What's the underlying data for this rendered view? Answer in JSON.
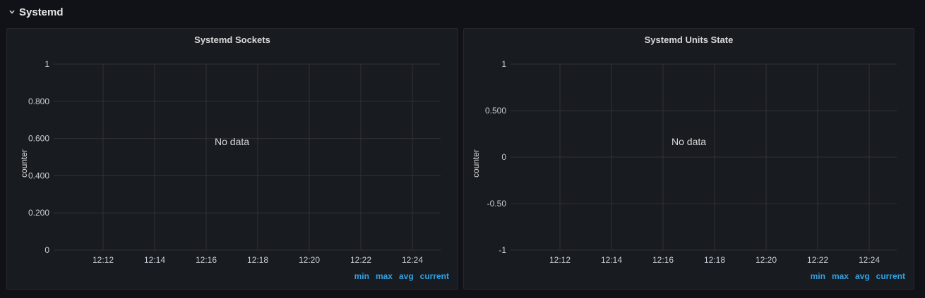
{
  "row": {
    "title": "Systemd",
    "chevron_icon": "chevron-down-icon"
  },
  "panels": [
    {
      "title": "Systemd Sockets",
      "ylabel": "counter",
      "no_data": "No data",
      "legend": [
        "min",
        "max",
        "avg",
        "current"
      ]
    },
    {
      "title": "Systemd Units State",
      "ylabel": "counter",
      "no_data": "No data",
      "legend": [
        "min",
        "max",
        "avg",
        "current"
      ]
    }
  ],
  "colors": {
    "background": "#111217",
    "panel": "#181b1f",
    "grid": "#2f3237",
    "legend_link": "#33a2e5"
  },
  "chart_data": [
    {
      "type": "line",
      "title": "Systemd Sockets",
      "ylabel": "counter",
      "xlabel": "",
      "x_ticks": [
        "12:12",
        "12:14",
        "12:16",
        "12:18",
        "12:20",
        "12:22",
        "12:24"
      ],
      "y_ticks": [
        "0",
        "0.200",
        "0.400",
        "0.600",
        "0.800",
        "1"
      ],
      "y_tick_values": [
        0,
        0.2,
        0.4,
        0.6,
        0.8,
        1
      ],
      "ylim": [
        0,
        1
      ],
      "series": [],
      "grid": true
    },
    {
      "type": "line",
      "title": "Systemd Units State",
      "ylabel": "counter",
      "xlabel": "",
      "x_ticks": [
        "12:12",
        "12:14",
        "12:16",
        "12:18",
        "12:20",
        "12:22",
        "12:24"
      ],
      "y_ticks": [
        "-1",
        "-0.50",
        "0",
        "0.500",
        "1"
      ],
      "y_tick_values": [
        -1,
        -0.5,
        0,
        0.5,
        1
      ],
      "ylim": [
        -1,
        1
      ],
      "series": [],
      "grid": true
    }
  ]
}
